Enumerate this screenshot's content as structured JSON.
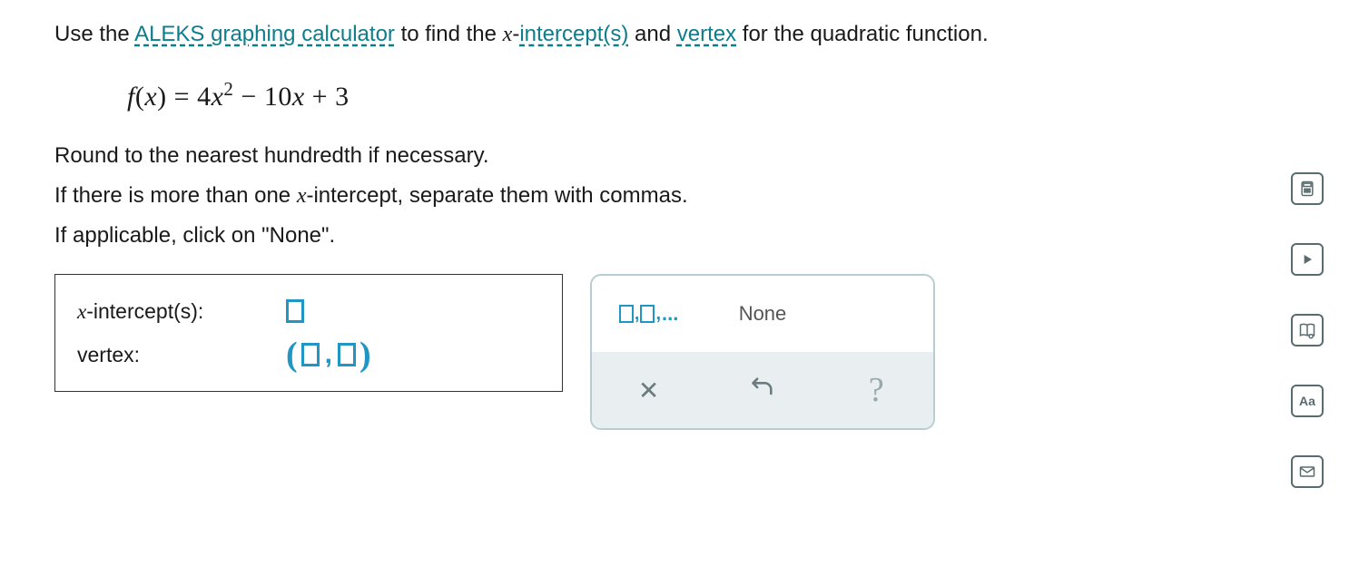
{
  "question": {
    "instruction_pre": "Use the ",
    "link_calc": "ALEKS graphing calculator",
    "instruction_mid1": " to find the ",
    "x_var": "x",
    "hyphen": "-",
    "link_intercepts": "intercept(s)",
    "instruction_mid2": " and ",
    "link_vertex": "vertex",
    "instruction_post": " for the quadratic function.",
    "equation_prefix": "f",
    "equation_paren_open": "(",
    "equation_var": "x",
    "equation_paren_close": ")",
    "equation_eq": " = ",
    "equation_rhs_a": "4",
    "equation_rhs_x": "x",
    "equation_rhs_sup": "2",
    "equation_rhs_b": " − 10",
    "equation_rhs_x2": "x",
    "equation_rhs_c": " + 3",
    "round_line": "Round to the nearest hundredth if necessary.",
    "multi_line_pre": "If there is more than one ",
    "multi_line_x": "x",
    "multi_line_post": "-intercept, separate them with commas.",
    "none_line": "If applicable, click on \"None\"."
  },
  "answers": {
    "x_intercept_label_pre": "x",
    "x_intercept_label_post": "-intercept(s):",
    "vertex_label": "vertex:"
  },
  "toolbox": {
    "list_sep": ",",
    "list_dots": "...",
    "none_label": "None"
  },
  "sidebar": {
    "calc": "calculator-icon",
    "video": "play-icon",
    "book": "book-icon",
    "text": "Aa",
    "mail": "mail-icon"
  }
}
